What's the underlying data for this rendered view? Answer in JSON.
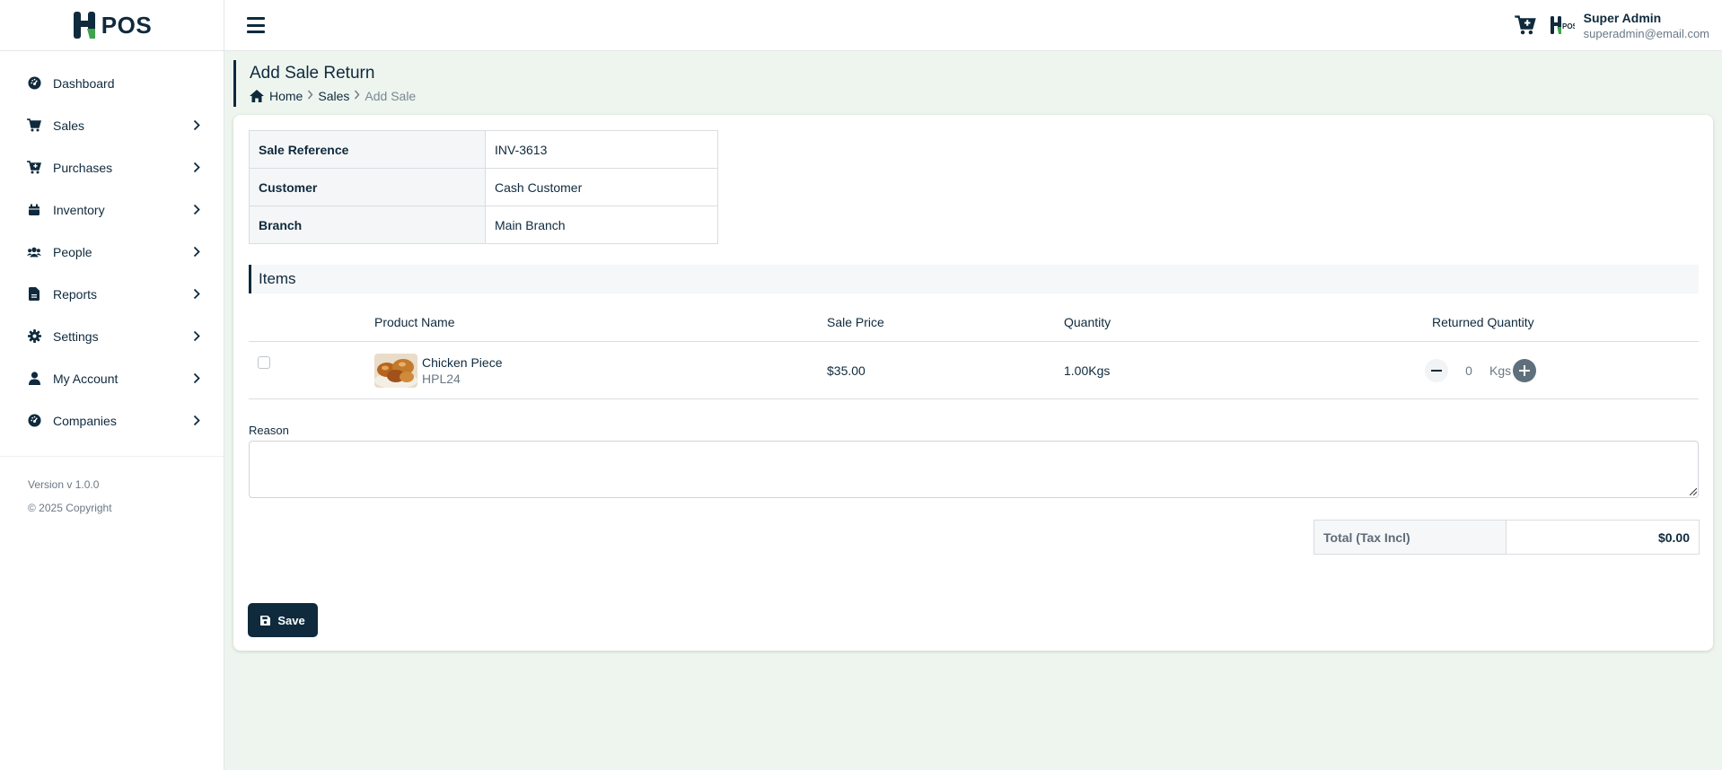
{
  "brand": {
    "name": "POS"
  },
  "sidebar": {
    "items": [
      {
        "label": "Dashboard",
        "icon": "dashboard-icon",
        "has_children": false
      },
      {
        "label": "Sales",
        "icon": "cart-icon",
        "has_children": true
      },
      {
        "label": "Purchases",
        "icon": "cart-plus-icon",
        "has_children": true
      },
      {
        "label": "Inventory",
        "icon": "box-icon",
        "has_children": true
      },
      {
        "label": "People",
        "icon": "users-icon",
        "has_children": true
      },
      {
        "label": "Reports",
        "icon": "file-icon",
        "has_children": true
      },
      {
        "label": "Settings",
        "icon": "gear-icon",
        "has_children": true
      },
      {
        "label": "My Account",
        "icon": "user-icon",
        "has_children": true
      },
      {
        "label": "Companies",
        "icon": "dashboard-icon",
        "has_children": true
      }
    ],
    "version": "Version v 1.0.0",
    "copyright": "© 2025 Copyright"
  },
  "header": {
    "user_name": "Super Admin",
    "user_email": "superadmin@email.com"
  },
  "page": {
    "title": "Add Sale Return",
    "breadcrumb": [
      "Home",
      "Sales",
      "Add Sale"
    ]
  },
  "sale_info": {
    "rows": [
      {
        "key": "Sale Reference",
        "value": "INV-3613"
      },
      {
        "key": "Customer",
        "value": "Cash Customer"
      },
      {
        "key": "Branch",
        "value": "Main Branch"
      }
    ]
  },
  "items": {
    "section_title": "Items",
    "columns": [
      "Product Name",
      "Sale Price",
      "Quantity",
      "Returned Quantity"
    ],
    "rows": [
      {
        "product_name": "Chicken Piece",
        "product_code": "HPL24",
        "sale_price": "$35.00",
        "quantity": "1.00Kgs",
        "returned_quantity": "0",
        "unit": "Kgs",
        "selected": false
      }
    ]
  },
  "reason": {
    "label": "Reason",
    "value": ""
  },
  "totals": {
    "label": "Total (Tax Incl)",
    "value": "$0.00"
  },
  "actions": {
    "save_label": "Save"
  },
  "colors": {
    "primary": "#0f2a3d",
    "background": "#eef5ef",
    "accent_green": "#3fa34d"
  }
}
